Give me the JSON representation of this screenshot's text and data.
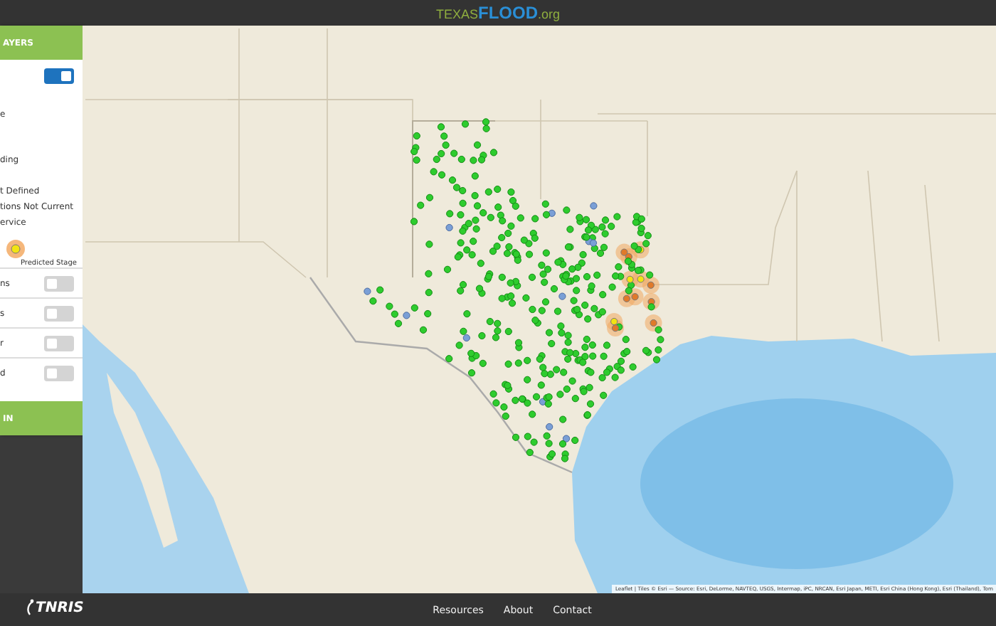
{
  "top_bar": {
    "logo": {
      "part_1": "TEXAS",
      "part_2": "FLOOD",
      "part_3": ".org"
    }
  },
  "sidebar": {
    "header": "AYERS",
    "master_toggle": {
      "on": true
    },
    "legend": [
      {
        "kind": "text",
        "label": "e"
      },
      {
        "kind": "text",
        "label": "ding"
      },
      {
        "kind": "text",
        "label": "t Defined"
      },
      {
        "kind": "text",
        "label": "tions Not Current"
      },
      {
        "kind": "text",
        "label": "ervice"
      },
      {
        "kind": "predicted",
        "label": "Predicted Stage"
      }
    ],
    "layers": [
      {
        "label": "ns",
        "on": false
      },
      {
        "label": "s",
        "on": false
      },
      {
        "label": "r",
        "on": false
      },
      {
        "label": "d",
        "on": false
      }
    ],
    "footer_button": "IN"
  },
  "map": {
    "attribution": "Leaflet | Tiles © Esri — Source: Esri, DeLorme, NAVTEQ, USGS, Intermap, iPC, NRCAN, Esri Japan, METI, Esri China (Hong Kong), Esri (Thailand), Tom"
  },
  "footer": {
    "logo": "TNRIS",
    "links": [
      "Resources",
      "About",
      "Contact"
    ]
  }
}
